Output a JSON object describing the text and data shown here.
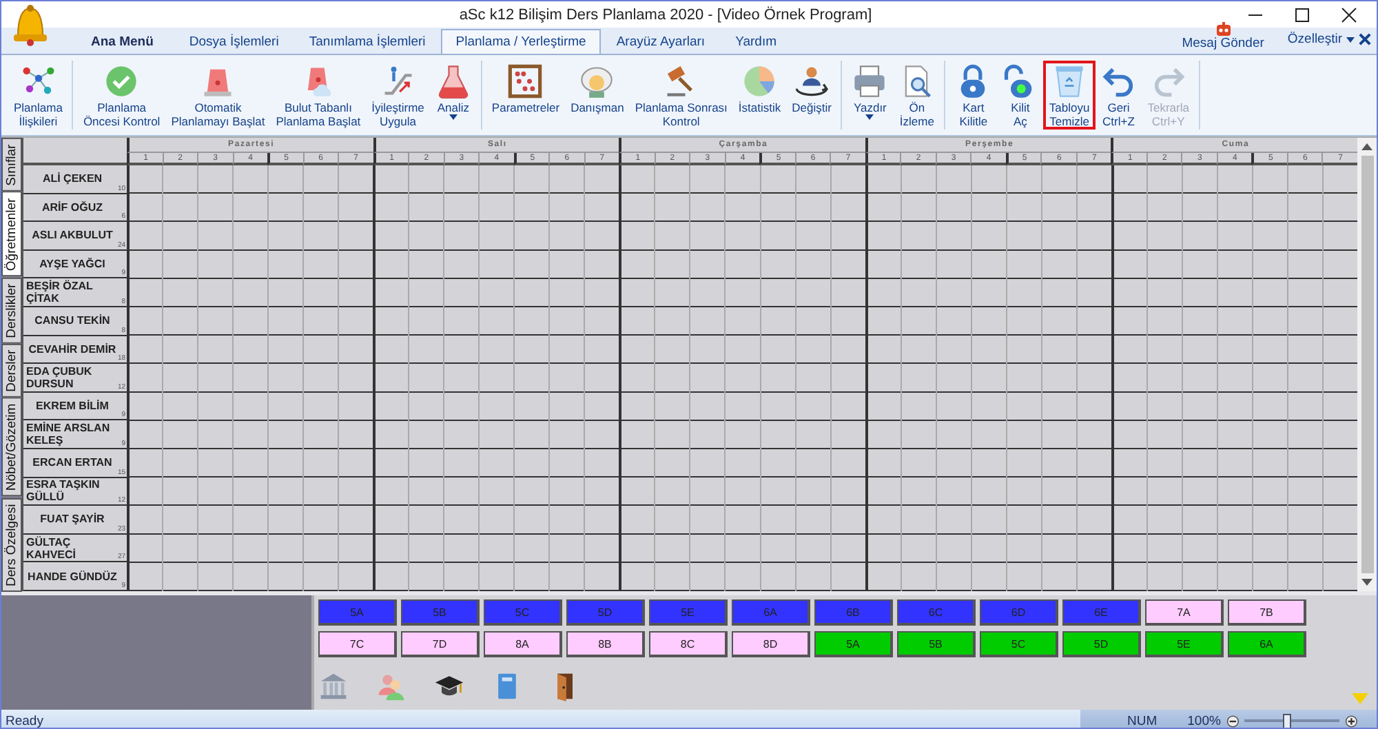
{
  "window": {
    "title": "aSc k12 Bilişim Ders Planlama 2020  - [Video Örnek Program]"
  },
  "ribbon_tabs": [
    {
      "label": "Ana Menü",
      "selected": false,
      "kind": "app"
    },
    {
      "label": "Dosya İşlemleri",
      "selected": false,
      "kind": "tab"
    },
    {
      "label": "Tanımlama İşlemleri",
      "selected": false,
      "kind": "tab"
    },
    {
      "label": "Planlama / Yerleştirme",
      "selected": true,
      "kind": "tab"
    },
    {
      "label": "Arayüz Ayarları",
      "selected": false,
      "kind": "tab"
    },
    {
      "label": "Yardım",
      "selected": false,
      "kind": "tab"
    }
  ],
  "message_button": {
    "label": "Mesaj Gönder"
  },
  "customize": {
    "label": "Özelleştir"
  },
  "ribbon": {
    "groups": [
      {
        "buttons": [
          {
            "label": "Planlama\nİlişkileri",
            "disabled": false,
            "dropdown": false,
            "highlighted": false
          }
        ]
      },
      {
        "buttons": [
          {
            "label": "Planlama\nÖncesi Kontrol",
            "disabled": false,
            "dropdown": false,
            "highlighted": false
          },
          {
            "label": "Otomatik\nPlanlamayı Başlat",
            "disabled": false,
            "dropdown": false,
            "highlighted": false
          },
          {
            "label": "Bulut Tabanlı\nPlanlama Başlat",
            "disabled": false,
            "dropdown": false,
            "highlighted": false
          },
          {
            "label": "İyileştirme\nUygula",
            "disabled": false,
            "dropdown": false,
            "highlighted": false
          },
          {
            "label": "Analiz",
            "disabled": false,
            "dropdown": true,
            "highlighted": false
          }
        ]
      },
      {
        "buttons": [
          {
            "label": "Parametreler",
            "disabled": false,
            "dropdown": false,
            "highlighted": false
          },
          {
            "label": "Danışman",
            "disabled": false,
            "dropdown": false,
            "highlighted": false
          },
          {
            "label": "Planlama Sonrası\nKontrol",
            "disabled": false,
            "dropdown": false,
            "highlighted": false
          },
          {
            "label": "İstatistik",
            "disabled": false,
            "dropdown": false,
            "highlighted": false
          },
          {
            "label": "Değiştir",
            "disabled": false,
            "dropdown": false,
            "highlighted": false
          }
        ]
      },
      {
        "buttons": [
          {
            "label": "Yazdır",
            "disabled": false,
            "dropdown": true,
            "highlighted": false
          },
          {
            "label": "Ön\nİzleme",
            "disabled": false,
            "dropdown": false,
            "highlighted": false
          }
        ]
      },
      {
        "buttons": [
          {
            "label": "Kart\nKilitle",
            "disabled": false,
            "dropdown": false,
            "highlighted": false
          },
          {
            "label": "Kilit\nAç",
            "disabled": false,
            "dropdown": false,
            "highlighted": false
          },
          {
            "label": "Tabloyu\nTemizle",
            "disabled": false,
            "dropdown": false,
            "highlighted": true
          },
          {
            "label": "Geri\nCtrl+Z",
            "disabled": false,
            "dropdown": false,
            "highlighted": false
          },
          {
            "label": "Tekrarla\nCtrl+Y",
            "disabled": true,
            "dropdown": false,
            "highlighted": false
          }
        ]
      }
    ]
  },
  "side_tabs": [
    {
      "label": "Sınıflar",
      "selected": false
    },
    {
      "label": "Öğretmenler",
      "selected": true
    },
    {
      "label": "Derslikler",
      "selected": false
    },
    {
      "label": "Dersler",
      "selected": false
    },
    {
      "label": "Nöbet/Gözetim",
      "selected": false
    },
    {
      "label": "Ders Özelgesi",
      "selected": false
    }
  ],
  "timetable": {
    "days": [
      {
        "name": "Pazartesi",
        "periods": [
          "1",
          "2",
          "3",
          "4",
          "5",
          "6",
          "7"
        ]
      },
      {
        "name": "Salı",
        "periods": [
          "1",
          "2",
          "3",
          "4",
          "5",
          "6",
          "7"
        ]
      },
      {
        "name": "Çarşamba",
        "periods": [
          "1",
          "2",
          "3",
          "4",
          "5",
          "6",
          "7"
        ]
      },
      {
        "name": "Perşembe",
        "periods": [
          "1",
          "2",
          "3",
          "4",
          "5",
          "6",
          "7"
        ]
      },
      {
        "name": "Cuma",
        "periods": [
          "1",
          "2",
          "3",
          "4",
          "5",
          "6",
          "7"
        ]
      }
    ],
    "teachers": [
      {
        "name": "ALİ ÇEKEN",
        "count": "10"
      },
      {
        "name": "ARİF OĞUZ",
        "count": "6"
      },
      {
        "name": "ASLI AKBULUT",
        "count": "24"
      },
      {
        "name": "AYŞE YAĞCI",
        "count": "9"
      },
      {
        "name": "BEŞİR ÖZAL ÇİTAK",
        "count": "8"
      },
      {
        "name": "CANSU TEKİN",
        "count": "8"
      },
      {
        "name": "CEVAHİR DEMİR",
        "count": "18"
      },
      {
        "name": "EDA ÇUBUK DURSUN",
        "count": "12"
      },
      {
        "name": "EKREM BİLİM",
        "count": "9"
      },
      {
        "name": "EMİNE ARSLAN KELEŞ",
        "count": "9"
      },
      {
        "name": "ERCAN ERTAN",
        "count": "15"
      },
      {
        "name": "ESRA TAŞKIN GÜLLÜ",
        "count": "12"
      },
      {
        "name": "FUAT ŞAYİR",
        "count": "23"
      },
      {
        "name": "GÜLTAÇ KAHVECİ",
        "count": "27"
      },
      {
        "name": "HANDE GÜNDÜZ",
        "count": "9"
      }
    ]
  },
  "cards": [
    {
      "label": "5A",
      "color": "#3333ff"
    },
    {
      "label": "5B",
      "color": "#3333ff"
    },
    {
      "label": "5C",
      "color": "#3333ff"
    },
    {
      "label": "5D",
      "color": "#3333ff"
    },
    {
      "label": "5E",
      "color": "#3333ff"
    },
    {
      "label": "6A",
      "color": "#3333ff"
    },
    {
      "label": "6B",
      "color": "#3333ff"
    },
    {
      "label": "6C",
      "color": "#3333ff"
    },
    {
      "label": "6D",
      "color": "#3333ff"
    },
    {
      "label": "6E",
      "color": "#3333ff"
    },
    {
      "label": "7A",
      "color": "#ffccff"
    },
    {
      "label": "7B",
      "color": "#ffccff"
    },
    {
      "label": "7C",
      "color": "#ffccff"
    },
    {
      "label": "7D",
      "color": "#ffccff"
    },
    {
      "label": "8A",
      "color": "#ffccff"
    },
    {
      "label": "8B",
      "color": "#ffccff"
    },
    {
      "label": "8C",
      "color": "#ffccff"
    },
    {
      "label": "8D",
      "color": "#ffccff"
    },
    {
      "label": "5A",
      "color": "#00cc00"
    },
    {
      "label": "5B",
      "color": "#00cc00"
    },
    {
      "label": "5C",
      "color": "#00cc00"
    },
    {
      "label": "5D",
      "color": "#00cc00"
    },
    {
      "label": "5E",
      "color": "#00cc00"
    },
    {
      "label": "6A",
      "color": "#00cc00"
    }
  ],
  "status_bar": {
    "status": "Ready",
    "num": "NUM",
    "zoom": {
      "reading": "100%",
      "level": 0.45
    }
  }
}
